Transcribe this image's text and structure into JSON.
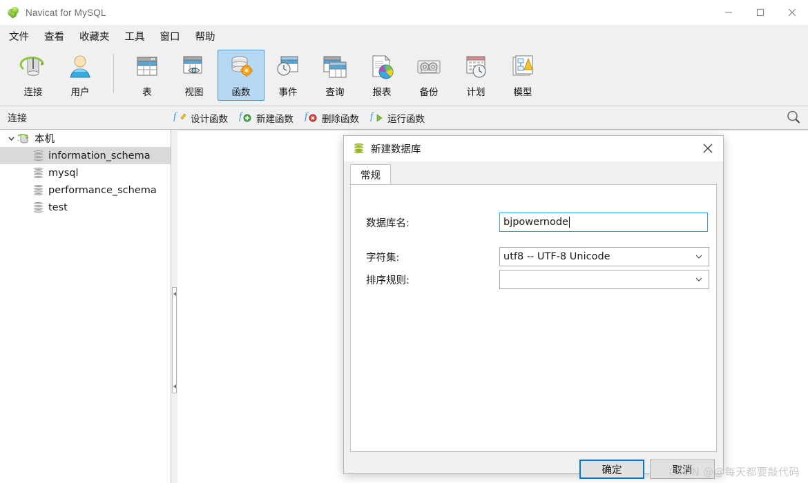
{
  "window": {
    "title": "Navicat for MySQL",
    "app_icon": "navicat-leaf-icon",
    "controls": {
      "minimize": "minimize-icon",
      "maximize": "maximize-icon",
      "close": "close-icon"
    }
  },
  "menubar": {
    "items": [
      {
        "label": "文件"
      },
      {
        "label": "查看"
      },
      {
        "label": "收藏夹"
      },
      {
        "label": "工具"
      },
      {
        "label": "窗口"
      },
      {
        "label": "帮助"
      }
    ]
  },
  "toolbar": {
    "groups": [
      {
        "buttons": [
          {
            "label": "连接",
            "icon": "connection-icon",
            "selected": false
          },
          {
            "label": "用户",
            "icon": "user-icon",
            "selected": false
          }
        ]
      },
      {
        "buttons": [
          {
            "label": "表",
            "icon": "table-icon",
            "selected": false
          },
          {
            "label": "视图",
            "icon": "view-icon",
            "selected": false
          },
          {
            "label": "函数",
            "icon": "function-icon",
            "selected": true
          },
          {
            "label": "事件",
            "icon": "event-icon",
            "selected": false
          },
          {
            "label": "查询",
            "icon": "query-icon",
            "selected": false
          },
          {
            "label": "报表",
            "icon": "report-icon",
            "selected": false
          },
          {
            "label": "备份",
            "icon": "backup-icon",
            "selected": false
          },
          {
            "label": "计划",
            "icon": "schedule-icon",
            "selected": false
          },
          {
            "label": "模型",
            "icon": "model-icon",
            "selected": false
          }
        ]
      }
    ]
  },
  "subbar": {
    "title": "连接",
    "actions": [
      {
        "label": "设计函数",
        "icon": "design-function-icon"
      },
      {
        "label": "新建函数",
        "icon": "new-function-icon"
      },
      {
        "label": "删除函数",
        "icon": "delete-function-icon"
      },
      {
        "label": "运行函数",
        "icon": "run-function-icon"
      }
    ],
    "search_icon": "search-icon"
  },
  "sidebar": {
    "root": {
      "label": "本机",
      "icon": "connection-node-icon",
      "expanded": true
    },
    "databases": [
      {
        "label": "information_schema",
        "icon": "database-icon",
        "selected": true
      },
      {
        "label": "mysql",
        "icon": "database-icon",
        "selected": false
      },
      {
        "label": "performance_schema",
        "icon": "database-icon",
        "selected": false
      },
      {
        "label": "test",
        "icon": "database-icon",
        "selected": false
      }
    ]
  },
  "dialog": {
    "title": "新建数据库",
    "title_icon": "database-green-icon",
    "close_icon": "close-icon",
    "tabs": [
      {
        "label": "常规",
        "active": true
      }
    ],
    "fields": {
      "db_name": {
        "label": "数据库名:",
        "value": "bjpowernode",
        "placeholder": ""
      },
      "charset": {
        "label": "字符集:",
        "value": "utf8 -- UTF-8 Unicode",
        "placeholder": ""
      },
      "collation": {
        "label": "排序规则:",
        "value": "",
        "placeholder": ""
      }
    },
    "buttons": {
      "ok": "确定",
      "cancel": "取消"
    }
  },
  "watermark": "CSDN @@每天都要敲代码",
  "colors": {
    "accent_blue": "#0078d7",
    "selected_toolbar_bg": "#b6d8f2",
    "chrome_gray": "#f0f0f0",
    "tree_selected": "#d9d9d9"
  }
}
